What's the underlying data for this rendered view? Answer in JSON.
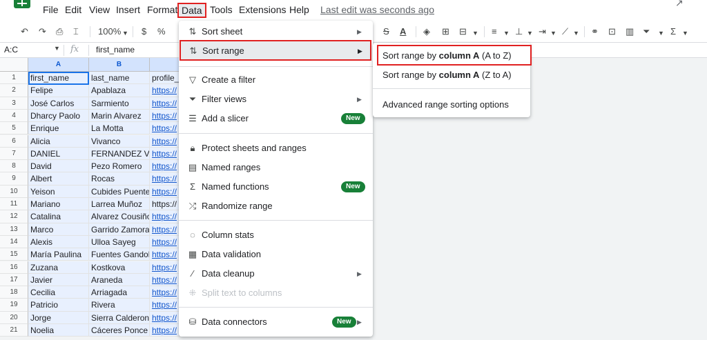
{
  "menubar": {
    "logo_icon": "sheets-logo-icon",
    "items": [
      "File",
      "Edit",
      "View",
      "Insert",
      "Format",
      "Data",
      "Tools",
      "Extensions",
      "Help"
    ],
    "last_edit": "Last edit was seconds ago"
  },
  "toolbar": {
    "zoom": "100%",
    "currency": "$",
    "percent": "%"
  },
  "formula_bar": {
    "name_box": "A:C",
    "fx": "fx",
    "value": "first_name"
  },
  "grid": {
    "columns": [
      "A",
      "B"
    ],
    "rows": [
      {
        "n": "1",
        "a": "first_name",
        "b": "last_name",
        "c": "profile_"
      },
      {
        "n": "2",
        "a": "Felipe",
        "b": "Apablaza",
        "c": "https://"
      },
      {
        "n": "3",
        "a": "José Carlos",
        "b": "Sarmiento",
        "c": "https://"
      },
      {
        "n": "4",
        "a": "Dharcy Paolo",
        "b": "Marin Alvarez",
        "c": "https://"
      },
      {
        "n": "5",
        "a": "Enrique",
        "b": "La Motta",
        "c": "https://"
      },
      {
        "n": "6",
        "a": "Alicia",
        "b": "Vivanco",
        "c": "https://"
      },
      {
        "n": "7",
        "a": "DANIEL",
        "b": "FERNANDEZ VA",
        "c": "https://"
      },
      {
        "n": "8",
        "a": "David",
        "b": "Pezo Romero",
        "c": "https://"
      },
      {
        "n": "9",
        "a": "Albert",
        "b": "Rocas",
        "c": "https://"
      },
      {
        "n": "10",
        "a": "Yeison",
        "b": "Cubides Puentes",
        "c": "https://"
      },
      {
        "n": "11",
        "a": "Mariano",
        "b": "Larrea Muñoz",
        "c": "https://"
      },
      {
        "n": "12",
        "a": "Catalina",
        "b": "Alvarez Cousiño",
        "c": "https://"
      },
      {
        "n": "13",
        "a": "Marco",
        "b": "Garrido Zamora",
        "c": "https://"
      },
      {
        "n": "14",
        "a": "Alexis",
        "b": "Ulloa Sayeg",
        "c": "https://"
      },
      {
        "n": "15",
        "a": "María Paulina",
        "b": "Fuentes Gandolfi",
        "c": "https://"
      },
      {
        "n": "16",
        "a": "Zuzana",
        "b": "Kostkova",
        "c": "https://"
      },
      {
        "n": "17",
        "a": "Javier",
        "b": "Araneda",
        "c": "https://"
      },
      {
        "n": "18",
        "a": "Cecilia",
        "b": "Arriagada",
        "c": "https://"
      },
      {
        "n": "19",
        "a": "Patricio",
        "b": "Rivera",
        "c": "https://"
      },
      {
        "n": "20",
        "a": "Jorge",
        "b": "Sierra Calderon",
        "c": "https://"
      },
      {
        "n": "21",
        "a": "Noelia",
        "b": "Cáceres Ponce",
        "c": "https://"
      }
    ]
  },
  "data_menu": {
    "items": [
      {
        "label": "Sort sheet",
        "icon": "sort-icon",
        "submenu": true
      },
      {
        "label": "Sort range",
        "icon": "sort-icon",
        "submenu": true
      },
      {
        "label": "Create a filter",
        "icon": "filter-icon"
      },
      {
        "label": "Filter views",
        "icon": "filter-views-icon",
        "submenu": true
      },
      {
        "label": "Add a slicer",
        "icon": "slicer-icon",
        "badge": "New"
      },
      {
        "label": "Protect sheets and ranges",
        "icon": "lock-icon"
      },
      {
        "label": "Named ranges",
        "icon": "named-ranges-icon"
      },
      {
        "label": "Named functions",
        "icon": "sigma-icon",
        "badge": "New"
      },
      {
        "label": "Randomize range",
        "icon": "shuffle-icon"
      },
      {
        "label": "Column stats",
        "icon": "lightbulb-icon"
      },
      {
        "label": "Data validation",
        "icon": "data-validation-icon"
      },
      {
        "label": "Data cleanup",
        "icon": "magic-wand-icon",
        "submenu": true
      },
      {
        "label": "Split text to columns",
        "icon": "split-icon",
        "disabled": true
      },
      {
        "label": "Data connectors",
        "icon": "database-icon",
        "badge": "New",
        "submenu": true
      }
    ]
  },
  "sort_submenu": {
    "a_to_z": {
      "prefix": "Sort range by ",
      "column": "column A",
      "suffix": " (A to Z)"
    },
    "z_to_a": {
      "prefix": "Sort range by ",
      "column": "column A",
      "suffix": " (Z to A)"
    },
    "advanced": "Advanced range sorting options"
  },
  "colors": {
    "highlight_border": "#e02020",
    "badge_green": "#188038",
    "selection_blue": "#e8f0fe",
    "active_cell": "#1a73e8"
  }
}
